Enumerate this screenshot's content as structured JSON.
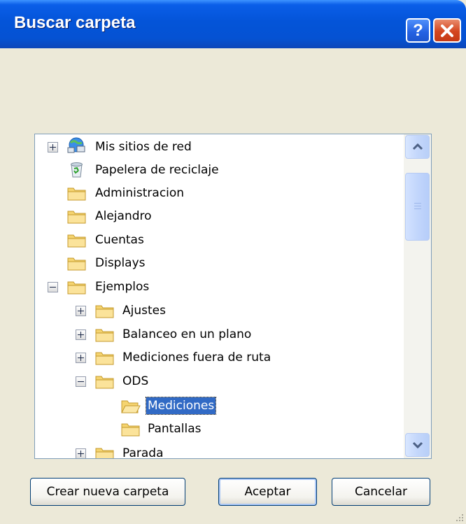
{
  "window": {
    "title": "Buscar carpeta",
    "help_label": "?",
    "close_label": "X"
  },
  "tree": {
    "items": [
      {
        "label": "Mis sitios de red",
        "icon": "network-places-icon",
        "expander": "plus"
      },
      {
        "label": "Papelera de reciclaje",
        "icon": "recycle-bin-icon",
        "expander": "none"
      },
      {
        "label": "Administracion",
        "icon": "folder-icon",
        "expander": "none"
      },
      {
        "label": "Alejandro",
        "icon": "folder-icon",
        "expander": "none"
      },
      {
        "label": "Cuentas",
        "icon": "folder-icon",
        "expander": "none"
      },
      {
        "label": "Displays",
        "icon": "folder-icon",
        "expander": "none"
      },
      {
        "label": "Ejemplos",
        "icon": "folder-icon",
        "expander": "minus"
      },
      {
        "label": "Ajustes",
        "icon": "folder-icon",
        "expander": "plus"
      },
      {
        "label": "Balanceo en un plano",
        "icon": "folder-icon",
        "expander": "plus"
      },
      {
        "label": "Mediciones fuera de ruta",
        "icon": "folder-icon",
        "expander": "plus"
      },
      {
        "label": "ODS",
        "icon": "folder-icon",
        "expander": "minus"
      },
      {
        "label": "Mediciones",
        "icon": "folder-open-icon",
        "expander": "none",
        "selected": true
      },
      {
        "label": "Pantallas",
        "icon": "folder-icon",
        "expander": "none"
      },
      {
        "label": "Parada",
        "icon": "folder-icon",
        "expander": "plus"
      }
    ]
  },
  "buttons": {
    "new_folder": "Crear nueva carpeta",
    "ok": "Aceptar",
    "cancel": "Cancelar"
  },
  "colors": {
    "titlebar": "#0454d8",
    "selection": "#316ac5",
    "dialog_bg": "#ece9d8"
  }
}
